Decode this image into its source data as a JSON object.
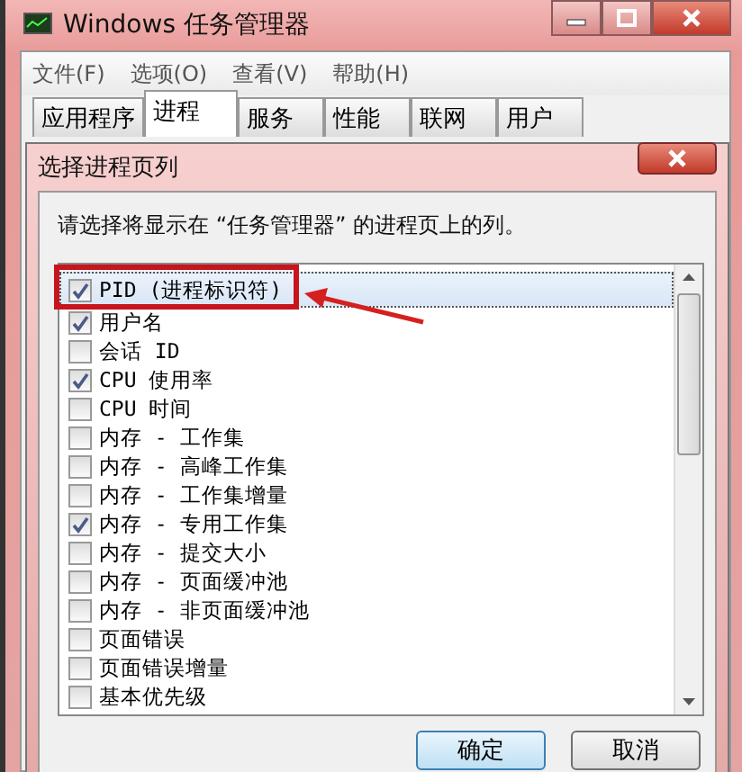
{
  "window": {
    "title": "Windows 任务管理器"
  },
  "menu": [
    "文件(F)",
    "选项(O)",
    "查看(V)",
    "帮助(H)"
  ],
  "tabs": [
    {
      "label": "应用程序",
      "selected": false
    },
    {
      "label": "进程",
      "selected": true
    },
    {
      "label": "服务",
      "selected": false
    },
    {
      "label": "性能",
      "selected": false
    },
    {
      "label": "联网",
      "selected": false
    },
    {
      "label": "用户",
      "selected": false
    }
  ],
  "dialog": {
    "title": "选择进程页列",
    "instruction": "请选择将显示在 “任务管理器” 的进程页上的列。",
    "columns": [
      {
        "label": "PID (进程标识符)",
        "checked": true,
        "selected": true
      },
      {
        "label": "用户名",
        "checked": true,
        "selected": false
      },
      {
        "label": "会话 ID",
        "checked": false,
        "selected": false
      },
      {
        "label": "CPU 使用率",
        "checked": true,
        "selected": false
      },
      {
        "label": "CPU 时间",
        "checked": false,
        "selected": false
      },
      {
        "label": "内存 - 工作集",
        "checked": false,
        "selected": false
      },
      {
        "label": "内存 - 高峰工作集",
        "checked": false,
        "selected": false
      },
      {
        "label": "内存 - 工作集增量",
        "checked": false,
        "selected": false
      },
      {
        "label": "内存 - 专用工作集",
        "checked": true,
        "selected": false
      },
      {
        "label": "内存 - 提交大小",
        "checked": false,
        "selected": false
      },
      {
        "label": "内存 - 页面缓冲池",
        "checked": false,
        "selected": false
      },
      {
        "label": "内存 - 非页面缓冲池",
        "checked": false,
        "selected": false
      },
      {
        "label": "页面错误",
        "checked": false,
        "selected": false
      },
      {
        "label": "页面错误增量",
        "checked": false,
        "selected": false
      },
      {
        "label": "基本优先级",
        "checked": false,
        "selected": false
      }
    ],
    "buttons": [
      "确定",
      "取消"
    ]
  }
}
